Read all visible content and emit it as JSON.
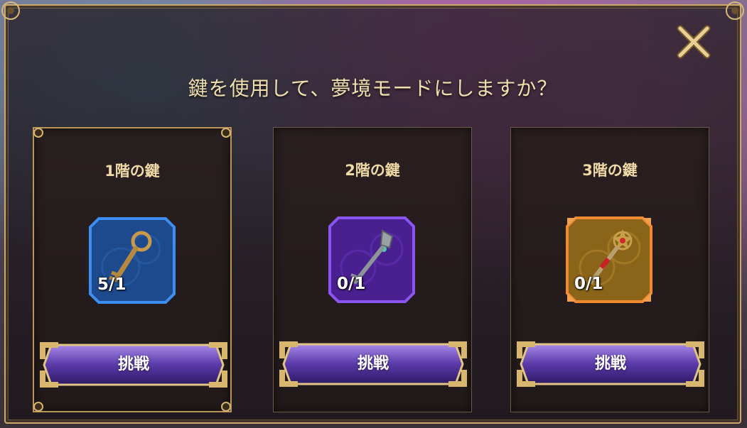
{
  "dialog": {
    "prompt": "鍵を使用して、夢境モードにしますか？"
  },
  "close": {
    "icon": "close-icon"
  },
  "cards": [
    {
      "title": "1階の鍵",
      "count": "5/1",
      "button": "挑戦",
      "rarity": "blue",
      "icon": "key-icon"
    },
    {
      "title": "2階の鍵",
      "count": "0/1",
      "button": "挑戦",
      "rarity": "purple",
      "icon": "key-icon"
    },
    {
      "title": "3階の鍵",
      "count": "0/1",
      "button": "挑戦",
      "rarity": "orange",
      "icon": "key-icon"
    }
  ],
  "colors": {
    "gold": "#c9a86a",
    "title_text": "#f0dfae",
    "blue_frame": "#2a6fd4",
    "purple_frame": "#7a3fd4",
    "orange_frame": "#e07a22"
  }
}
